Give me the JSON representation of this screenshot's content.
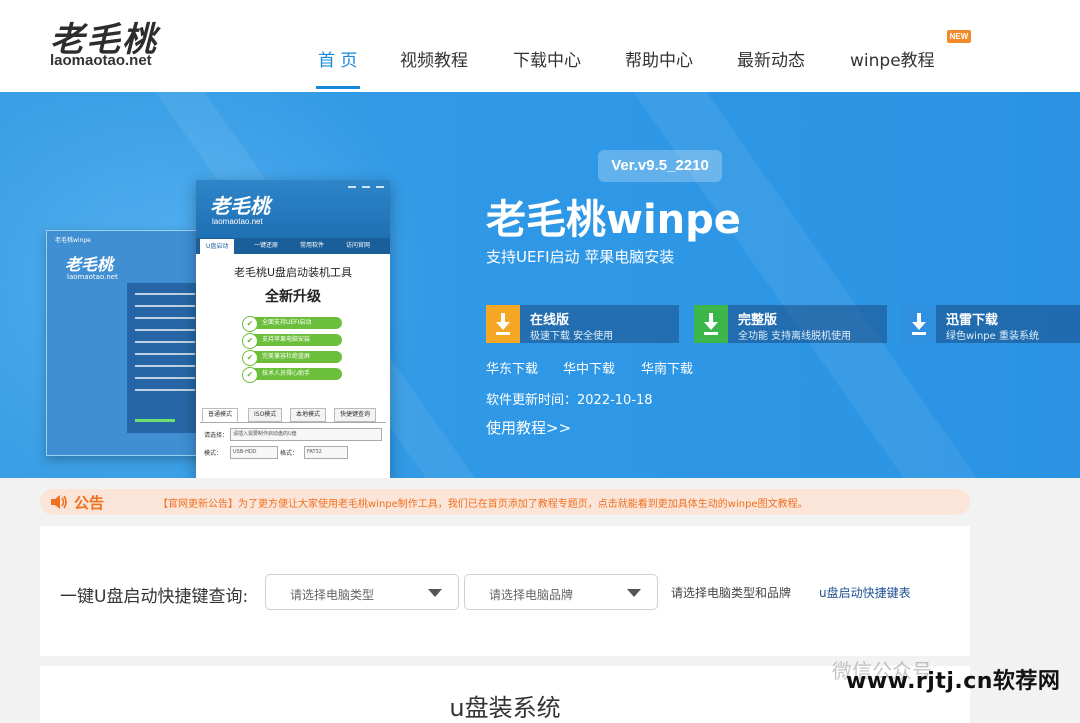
{
  "header": {
    "logo_cn": "老毛桃",
    "logo_en": "laomaotao.net",
    "nav": [
      {
        "label": "首 页",
        "active": true
      },
      {
        "label": "视频教程",
        "active": false
      },
      {
        "label": "下载中心",
        "active": false
      },
      {
        "label": "帮助中心",
        "active": false
      },
      {
        "label": "最新动态",
        "active": false
      },
      {
        "label": "winpe教程",
        "active": false
      }
    ],
    "new_badge": "NEW"
  },
  "hero": {
    "version": "Ver.v9.5_2210",
    "title": "老毛桃winpe",
    "subtitle": "支持UEFI启动 苹果电脑安装",
    "downloads": [
      {
        "name": "在线版",
        "desc": "极速下载 安全使用",
        "icon_color": "#f5a623",
        "icon": "download-icon"
      },
      {
        "name": "完整版",
        "desc": "全功能 支持离线脱机使用",
        "icon_color": "#3cb54a",
        "icon": "download-icon"
      },
      {
        "name": "迅雷下载",
        "desc": "绿色winpe 重装系统",
        "icon_color": "#2f8fe0",
        "icon": "download-icon"
      }
    ],
    "regions": [
      "华东下载",
      "华中下载",
      "华南下载"
    ],
    "update_label": "软件更新时间：",
    "update_date": "2022-10-18",
    "tutorial_link": "使用教程>>",
    "mock_app": {
      "logo_cn": "老毛桃",
      "logo_en": "laomaotao.net",
      "tabs": [
        "U盘启动",
        "一键还原",
        "常用软件",
        "访问官网"
      ],
      "title": "老毛桃U盘启动装机工具",
      "subtitle": "全新升级",
      "features": [
        "全面支持UEFI启动",
        "支持苹果电脑安装",
        "完美兼容杜绝蓝屏",
        "技术人员得心助手"
      ],
      "modes": [
        "普通模式",
        "ISO模式",
        "本地模式",
        "快捷键查询"
      ],
      "select_label": "请选择：",
      "select_value": "请插入需要制作启动盘的U盘",
      "mode_label": "模式：",
      "mode_value": "USB-HDD",
      "format_label": "格式：",
      "format_value": "FAT32",
      "back_title": "老毛桃winpe",
      "back_logo_cn": "老毛桃",
      "back_logo_en": "laomaotao.net"
    }
  },
  "notice": {
    "label": "公告",
    "text": "【官网更新公告】为了更方便让大家使用老毛桃winpe制作工具，我们已在首页添加了教程专题页，点击就能看到更加具体生动的winpe图文教程。"
  },
  "query": {
    "label": "一键U盘启动快捷键查询:",
    "select_type_placeholder": "请选择电脑类型",
    "select_brand_placeholder": "请选择电脑品牌",
    "hint": "请选择电脑类型和品牌",
    "link": "u盘启动快捷键表"
  },
  "section": {
    "title": "u盘装系统"
  },
  "watermark": {
    "text": "www.rjtj.cn软荐网",
    "faint": "微信公众号"
  }
}
